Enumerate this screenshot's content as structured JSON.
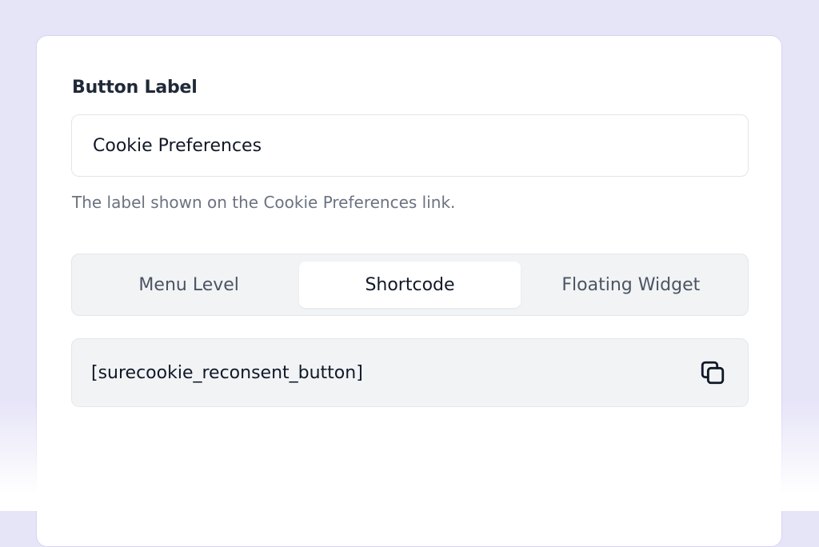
{
  "form": {
    "field_label": "Button Label",
    "input_value": "Cookie Preferences",
    "help_text": "The label shown on the Cookie Preferences link."
  },
  "tabs": [
    {
      "label": "Menu Level",
      "active": false
    },
    {
      "label": "Shortcode",
      "active": true
    },
    {
      "label": "Floating Widget",
      "active": false
    }
  ],
  "shortcode": {
    "text": "[surecookie_reconsent_button]",
    "copy_icon": "copy-icon"
  },
  "colors": {
    "background": "#e6e4f7",
    "card_border": "#d7d3f3",
    "panel_bg": "#f1f3f5"
  }
}
